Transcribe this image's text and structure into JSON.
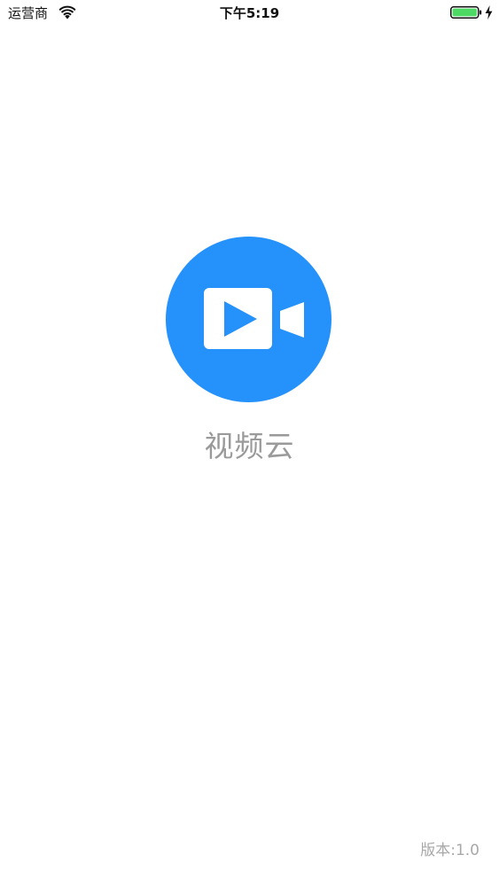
{
  "status_bar": {
    "carrier": "运营商",
    "time": "下午5:19",
    "icons": [
      "wifi-icon",
      "battery-icon",
      "charging-bolt-icon"
    ],
    "battery_color": "#4cd964"
  },
  "splash": {
    "logo_icon": "video-camera-play-icon",
    "logo_color": "#2592fb",
    "app_name": "视频云",
    "version": "版本:1.0"
  }
}
